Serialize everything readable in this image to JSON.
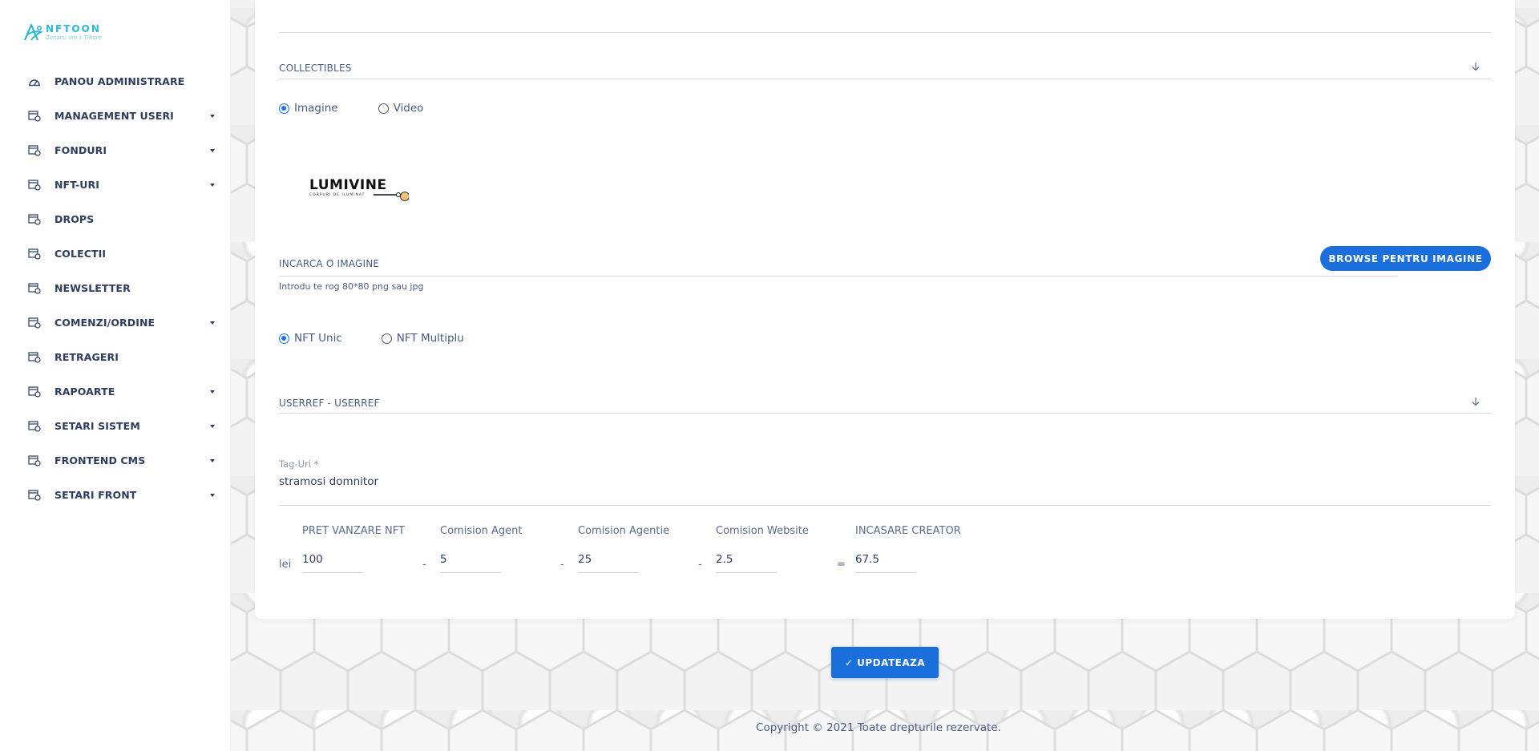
{
  "brand": {
    "name": "NFTOON",
    "tagline": "Zonacu om s Tiltore"
  },
  "sidebar": {
    "items": [
      {
        "label": "PANOU ADMINISTRARE",
        "has_submenu": false,
        "icon": "dashboard-icon"
      },
      {
        "label": "MANAGEMENT USERI",
        "has_submenu": true,
        "icon": "module-icon"
      },
      {
        "label": "FONDURI",
        "has_submenu": true,
        "icon": "module-icon"
      },
      {
        "label": "NFT-URI",
        "has_submenu": true,
        "icon": "module-icon"
      },
      {
        "label": "DROPS",
        "has_submenu": false,
        "icon": "module-icon"
      },
      {
        "label": "COLECTII",
        "has_submenu": false,
        "icon": "module-icon"
      },
      {
        "label": "NEWSLETTER",
        "has_submenu": false,
        "icon": "module-icon"
      },
      {
        "label": "COMENZI/ORDINE",
        "has_submenu": true,
        "icon": "module-icon"
      },
      {
        "label": "RETRAGERI",
        "has_submenu": false,
        "icon": "module-icon"
      },
      {
        "label": "RAPOARTE",
        "has_submenu": true,
        "icon": "module-icon"
      },
      {
        "label": "SETARI SISTEM",
        "has_submenu": true,
        "icon": "module-icon"
      },
      {
        "label": "FRONTEND CMS",
        "has_submenu": true,
        "icon": "module-icon"
      },
      {
        "label": "SETARI FRONT",
        "has_submenu": true,
        "icon": "module-icon"
      }
    ]
  },
  "form": {
    "category": {
      "selected": "COLLECTIBLES"
    },
    "media_type": {
      "options": [
        "Imagine",
        "Video"
      ],
      "selected": "Imagine"
    },
    "preview": {
      "logo_text": "LUMIVINE",
      "logo_subtext": "CORPURI DE ILUMINAT"
    },
    "upload": {
      "label": "INCARCA O IMAGINE",
      "button_label": "BROWSE PENTRU IMAGINE",
      "hint": "Introdu te rog 80*80 png sau jpg"
    },
    "nft_type": {
      "options": [
        "NFT Unic",
        "NFT Multiplu"
      ],
      "selected": "NFT Unic"
    },
    "user": {
      "selected": "USERREF - USERREF"
    },
    "tags": {
      "label": "Tag-Uri *",
      "value": "stramosi domnitor"
    },
    "pricing": {
      "currency": "lei",
      "columns": [
        {
          "label": "PRET VANZARE NFT",
          "value": "100"
        },
        {
          "label": "Comision Agent",
          "value": "5"
        },
        {
          "label": "Comision Agentie",
          "value": "25"
        },
        {
          "label": "Comision Website",
          "value": "2.5"
        },
        {
          "label": "INCASARE CREATOR",
          "value": "67.5"
        }
      ],
      "operators": [
        "-",
        "-",
        "-",
        "="
      ]
    },
    "submit_label": "✓ UPDATEAZA"
  },
  "footer": {
    "copyright": "Copyright © 2021 Toate drepturile rezervate."
  },
  "colors": {
    "accent": "#1a6fdc",
    "brand": "#2fb8d6",
    "nav_text": "#2e3d5f"
  }
}
